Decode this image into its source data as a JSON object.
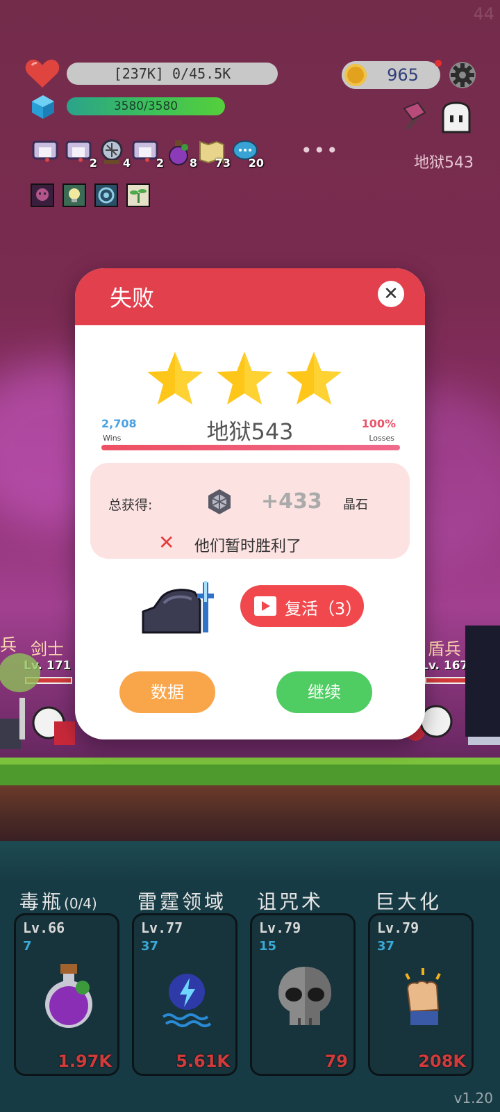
{
  "fps": "44",
  "hud": {
    "hp_text": "[237K] 0/45.5K",
    "mp_text": "3580/3580",
    "coins": "965",
    "stage_label": "地狱543"
  },
  "items": [
    {
      "name": "scroll-icon",
      "count": ""
    },
    {
      "name": "scroll-icon",
      "count": "2"
    },
    {
      "name": "crystal-ball-icon",
      "count": "4"
    },
    {
      "name": "scroll-icon",
      "count": "2"
    },
    {
      "name": "potion-icon",
      "count": "8"
    },
    {
      "name": "map-icon",
      "count": "73"
    },
    {
      "name": "chat-icon",
      "count": "20"
    }
  ],
  "buffs": [
    "skull-buff-icon",
    "lightbulb-buff-icon",
    "vortex-buff-icon",
    "sprout-buff-icon"
  ],
  "units": {
    "left_partial": "兵",
    "left_name": "剑士",
    "left_level": "Lv. 171",
    "right_name": "盾兵",
    "right_level": "Lv. 167"
  },
  "modal": {
    "title": "失败",
    "close_symbol": "✕",
    "stars": 3,
    "stage": "地狱543",
    "wins_number": "2,708",
    "wins_label": "Wins",
    "losses_percent": "100%",
    "losses_label": "Losses",
    "reward_label": "总获得:",
    "reward_value": "+433",
    "reward_unit": "晶石",
    "fail_symbol": "✕",
    "fail_message": "他们暂时胜利了",
    "revive_label": "复活（3）",
    "data_button": "数据",
    "continue_button": "继续"
  },
  "skills": [
    {
      "name": "毒瓶",
      "extra": "(0/4)",
      "level": "Lv.66",
      "cost": "7",
      "price": "1.97K",
      "icon": "poison-bottle-icon"
    },
    {
      "name": "雷霆领域",
      "extra": "",
      "level": "Lv.77",
      "cost": "37",
      "price": "5.61K",
      "icon": "thunder-field-icon"
    },
    {
      "name": "诅咒术",
      "extra": "",
      "level": "Lv.79",
      "cost": "15",
      "price": "79",
      "icon": "skull-icon"
    },
    {
      "name": "巨大化",
      "extra": "",
      "level": "Lv.79",
      "cost": "37",
      "price": "208K",
      "icon": "fist-icon"
    }
  ],
  "version": "v1.20",
  "colors": {
    "header_red": "#e2404c",
    "continue_green": "#4fcd63",
    "data_orange": "#f9a64a",
    "star_yellow": "#ffc61a"
  }
}
